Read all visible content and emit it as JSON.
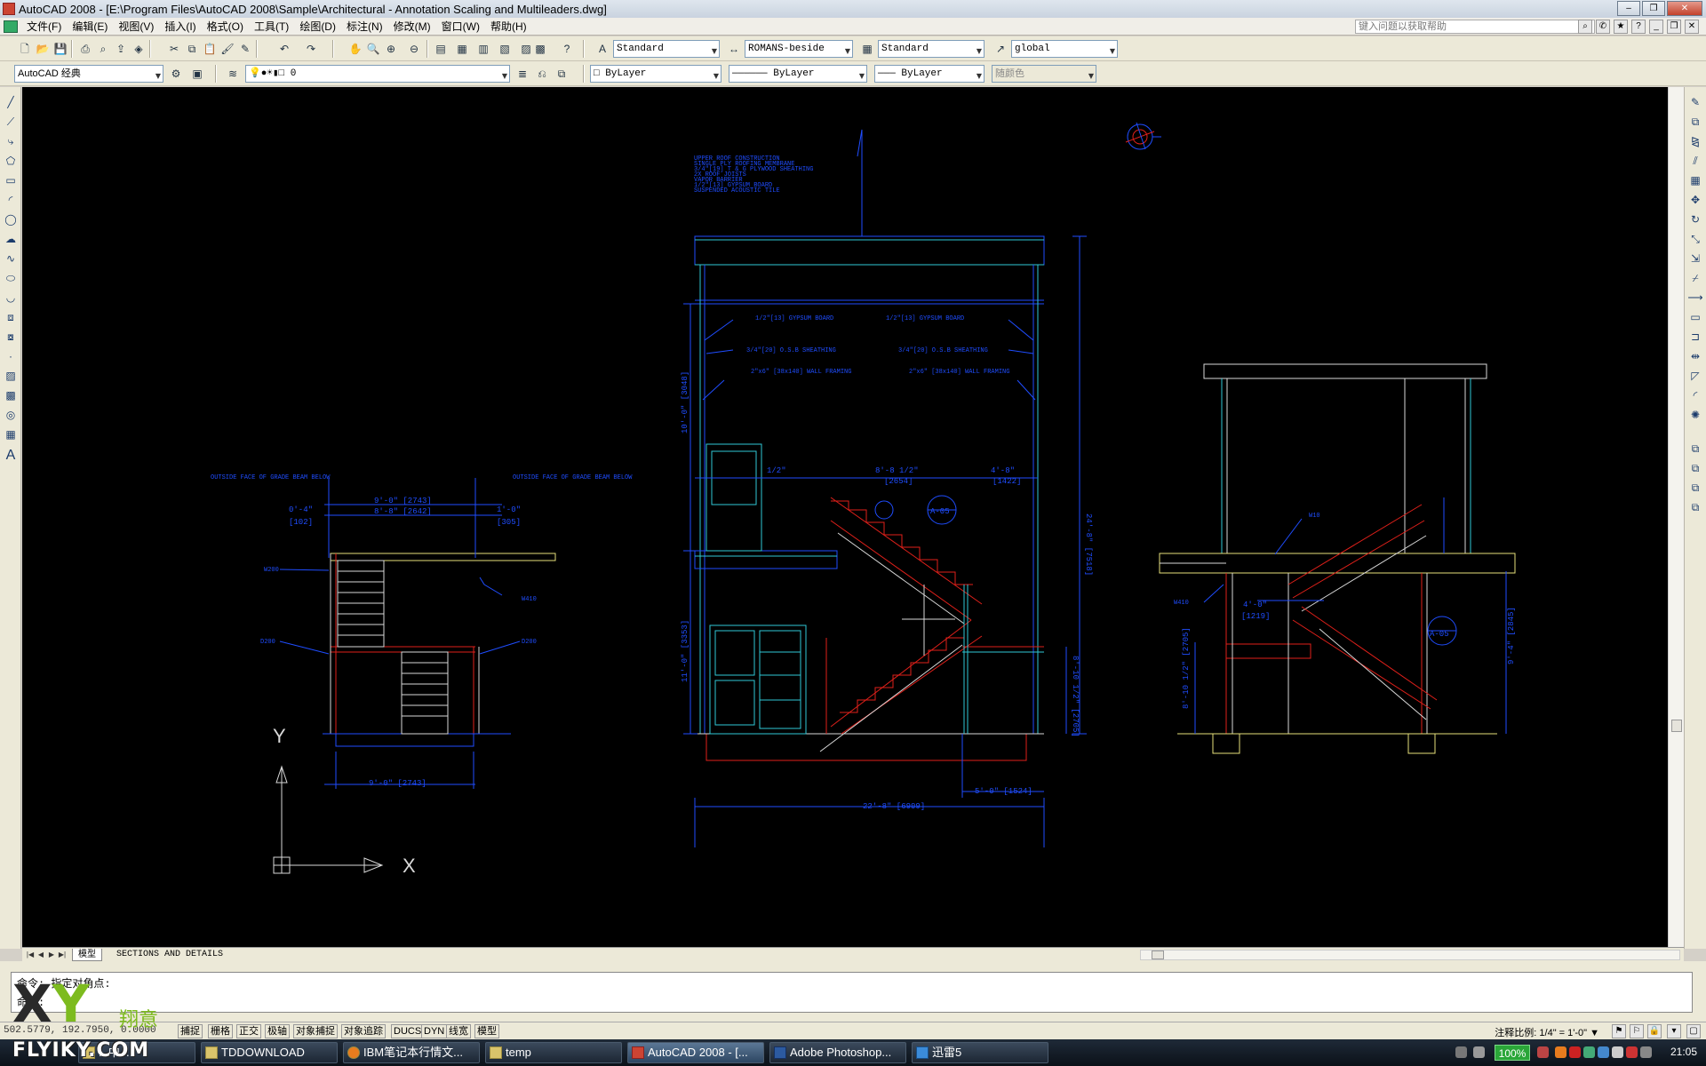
{
  "window": {
    "title": "AutoCAD 2008 - [E:\\Program Files\\AutoCAD 2008\\Sample\\Architectural - Annotation Scaling and Multileaders.dwg]"
  },
  "menu": {
    "items": [
      "文件(F)",
      "编辑(E)",
      "视图(V)",
      "插入(I)",
      "格式(O)",
      "工具(T)",
      "绘图(D)",
      "标注(N)",
      "修改(M)",
      "窗口(W)",
      "帮助(H)"
    ],
    "help_placeholder": "键入问题以获取帮助"
  },
  "toolbar": {
    "text_style": "Standard",
    "dim_style": "ROMANS-beside",
    "table_style": "Standard",
    "mleader_style": "global",
    "workspace": "AutoCAD 经典",
    "layer": "0",
    "color": "ByLayer",
    "linetype": "ByLayer",
    "lineweight": "ByLayer",
    "plot_style": "随颜色"
  },
  "drawing": {
    "notes_main": [
      "UPPER ROOF CONSTRUCTION",
      "SINGLE PLY ROOFING MEMBRANE",
      "3/4\"[19] T & G PLYWOOD SHEATHING",
      "2X ROOF JOISTS",
      "VAPOR BARRIER",
      "1/2\"[13] GYPSUM BOARD",
      "SUSPENDED ACOUSTIC TILE"
    ],
    "gyp_left": "1/2\"[13] GYPSUM BOARD",
    "gyp_right": "1/2\"[13] GYPSUM BOARD",
    "osb_left": "3/4\"[20] O.S.B SHEATHING",
    "osb_right": "3/4\"[20] O.S.B SHEATHING",
    "wall_left": "2\"x6\" [38x140] WALL FRAMING",
    "wall_right": "2\"x6\" [38x140] WALL FRAMING",
    "dim_bottom": "22'-8\" [6909]",
    "dim_bottom_right": "5'-0\" [1524]",
    "dim_mid": "8'-8 1/2\"",
    "dim_mid_mm": "[2654]",
    "dim_small_a": "1/2\"",
    "dim_small_b": "4'-8\"",
    "dim_small_b_mm": "[1422]",
    "dim_vert_left_top": "10'-0\" [3048]",
    "dim_vert_left_bot": "11'-0\" [3353]",
    "dim_vert_right": "24'-8\" [7518]",
    "dim_vert_right_low": "8'-10 1/2\" [2705]",
    "left_notes_outside_l": "OUTSIDE FACE OF GRADE BEAM BELOW",
    "left_notes_outside_r": "OUTSIDE FACE OF GRADE BEAM BELOW",
    "left_dim_top": "9'-0\" [2743]",
    "left_dim_top2": "8'-8\" [2642]",
    "left_dim_l": "0'-4\"",
    "left_dim_l_mm": "[102]",
    "left_dim_r": "1'-0\"",
    "left_dim_r_mm": "[305]",
    "left_dim_bottom": "9'-0\" [2743]",
    "left_tag_1": "W200",
    "left_tag_2": "W410",
    "left_tag_3": "D200",
    "left_tag_4": "D200",
    "right_tag_1": "W10",
    "right_tag_2": "W410",
    "right_dim_a": "4'-0\"",
    "right_dim_a_mm": "[1219]",
    "right_dim_b": "8'-10 1/2\" [2705]",
    "right_dim_c": "9'-4\" [2845]",
    "section_tag": "A-05",
    "ucs_x": "X",
    "ucs_y": "Y"
  },
  "tabs": {
    "model": "模型",
    "layout": "SECTIONS AND DETAILS"
  },
  "command": {
    "line1": "命令:  指定对角点:",
    "line2": "命令:"
  },
  "status": {
    "coords": "502.5779, 192.7950, 0.0000",
    "toggles": [
      "捕捉",
      "栅格",
      "正交",
      "极轴",
      "对象捕捉",
      "对象追踪",
      "DUCS",
      "DYN",
      "线宽",
      "模型"
    ],
    "annotation_scale_label": "注释比例:",
    "annotation_scale": "1/4\" = 1'-0\""
  },
  "taskbar": {
    "tasks": [
      "...中...",
      "TDDOWNLOAD",
      "IBM笔记本行情文...",
      "temp",
      "AutoCAD 2008 - [...",
      "Adobe Photoshop...",
      "迅雷5"
    ],
    "battery": "100%",
    "time": "21:05"
  },
  "watermark": {
    "brand_x": "X",
    "brand_y": "Y",
    "brand_cn": "翔意",
    "site": "FLYIKY.COM"
  },
  "colors": {
    "canvas_bg": "#000000",
    "line_blue": "#1f4dff",
    "line_cyan": "#2fc7d6",
    "line_red": "#e0201a",
    "line_white": "#d8d8d8",
    "line_yellow": "#e6e07a"
  }
}
